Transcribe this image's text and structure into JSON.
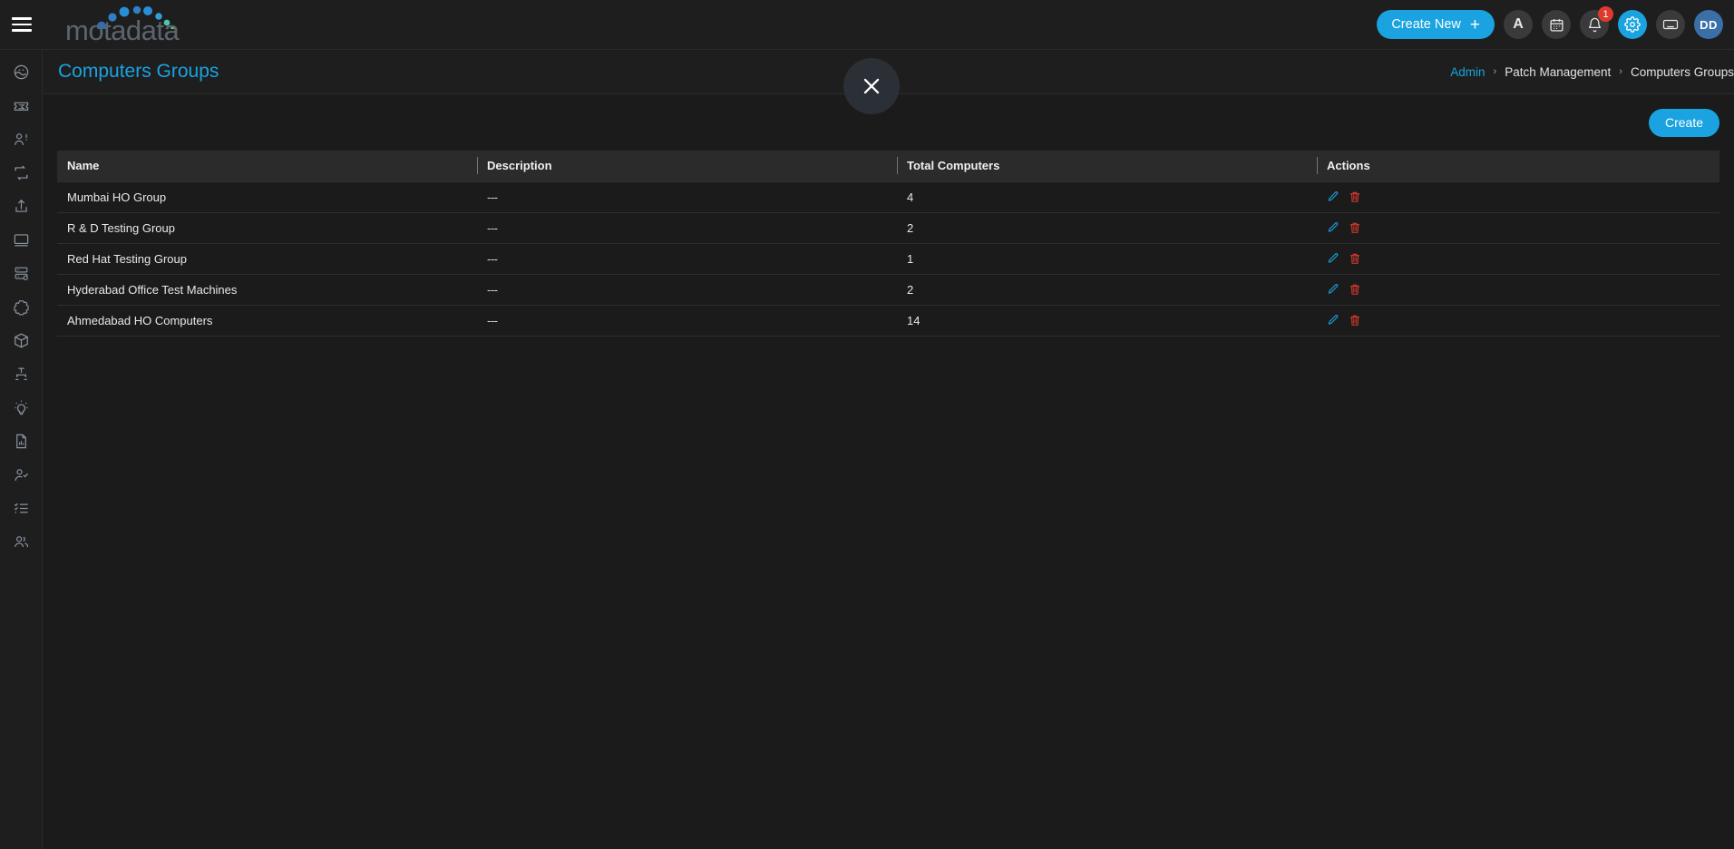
{
  "brand": {
    "logo_text": "motadata"
  },
  "topbar": {
    "menu_icon": "hamburger-icon",
    "create_new_label": "Create New",
    "create_new_plus": "+",
    "announcement_letter": "A",
    "calendar_icon": "calendar-icon",
    "notification_icon": "bell-icon",
    "notification_count": "1",
    "settings_icon": "gear-icon",
    "keyboard_icon": "keyboard-icon",
    "avatar_initials": "DD"
  },
  "sidebar": {
    "items": [
      {
        "icon": "dashboard-globe-icon"
      },
      {
        "icon": "ticket-icon"
      },
      {
        "icon": "user-alert-icon"
      },
      {
        "icon": "loop-refresh-icon"
      },
      {
        "icon": "upload-icon"
      },
      {
        "icon": "monitor-icon"
      },
      {
        "icon": "server-settings-icon"
      },
      {
        "icon": "puzzle-gear-icon"
      },
      {
        "icon": "cube-icon"
      },
      {
        "icon": "hierarchy-icon"
      },
      {
        "icon": "lightbulb-icon"
      },
      {
        "icon": "report-document-icon"
      },
      {
        "icon": "user-check-icon"
      },
      {
        "icon": "checklist-icon"
      },
      {
        "icon": "users-group-icon"
      }
    ]
  },
  "page": {
    "title": "Computers Groups",
    "close_icon": "close-icon",
    "breadcrumb": [
      {
        "label": "Admin",
        "link": true
      },
      {
        "label": "Patch Management",
        "link": false
      },
      {
        "label": "Computers Groups",
        "link": false
      }
    ],
    "breadcrumb_separator": "›"
  },
  "toolbar": {
    "create_label": "Create"
  },
  "table": {
    "columns": [
      "Name",
      "Description",
      "Total Computers",
      "Actions"
    ],
    "rows": [
      {
        "name": "Mumbai HO Group",
        "description": "---",
        "total_computers": "4",
        "edit_icon": "pencil-icon",
        "delete_icon": "trash-icon"
      },
      {
        "name": "R & D Testing Group",
        "description": "---",
        "total_computers": "2",
        "edit_icon": "pencil-icon",
        "delete_icon": "trash-icon"
      },
      {
        "name": "Red Hat Testing Group",
        "description": "---",
        "total_computers": "1",
        "edit_icon": "pencil-icon",
        "delete_icon": "trash-icon"
      },
      {
        "name": "Hyderabad Office Test Machines",
        "description": "---",
        "total_computers": "2",
        "edit_icon": "pencil-icon",
        "delete_icon": "trash-icon"
      },
      {
        "name": "Ahmedabad HO Computers",
        "description": "---",
        "total_computers": "14",
        "edit_icon": "pencil-icon",
        "delete_icon": "trash-icon"
      }
    ]
  },
  "colors": {
    "accent": "#1aa3e0",
    "danger": "#e03a2f",
    "page_bg": "#1b1b1b",
    "panel_bg": "#1e1e1e",
    "header_row_bg": "#2b2b2b",
    "avatar_bg": "#3b6fa8"
  }
}
